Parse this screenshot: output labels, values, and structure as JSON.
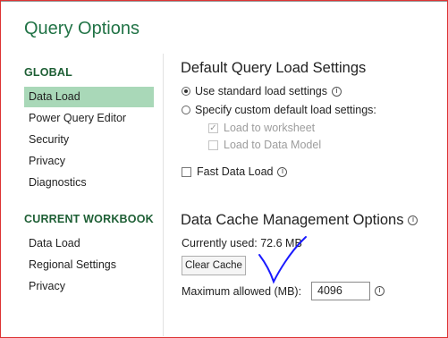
{
  "title": "Query Options",
  "sidebar": {
    "global_header": "GLOBAL",
    "global_items": [
      "Data Load",
      "Power Query Editor",
      "Security",
      "Privacy",
      "Diagnostics"
    ],
    "current_header": "CURRENT WORKBOOK",
    "current_items": [
      "Data Load",
      "Regional Settings",
      "Privacy"
    ],
    "selected": "Data Load"
  },
  "load_settings": {
    "heading": "Default Query Load Settings",
    "standard_label": "Use standard load settings",
    "custom_label": "Specify custom default load settings:",
    "load_worksheet_label": "Load to worksheet",
    "load_model_label": "Load to Data Model",
    "fast_load_label": "Fast Data Load",
    "standard_selected": true,
    "load_worksheet_checked": true,
    "load_model_checked": false,
    "fast_load_checked": false
  },
  "cache": {
    "heading": "Data Cache Management Options",
    "currently_used": "Currently used: 72.6 MB",
    "clear_button": "Clear Cache",
    "max_label": "Maximum allowed (MB):",
    "max_value": "4096"
  },
  "icons": {
    "info": "i",
    "check": "✓"
  },
  "colors": {
    "title": "#217346",
    "selected_bg": "#a9d8b8",
    "annotation": "#1a1aff"
  }
}
